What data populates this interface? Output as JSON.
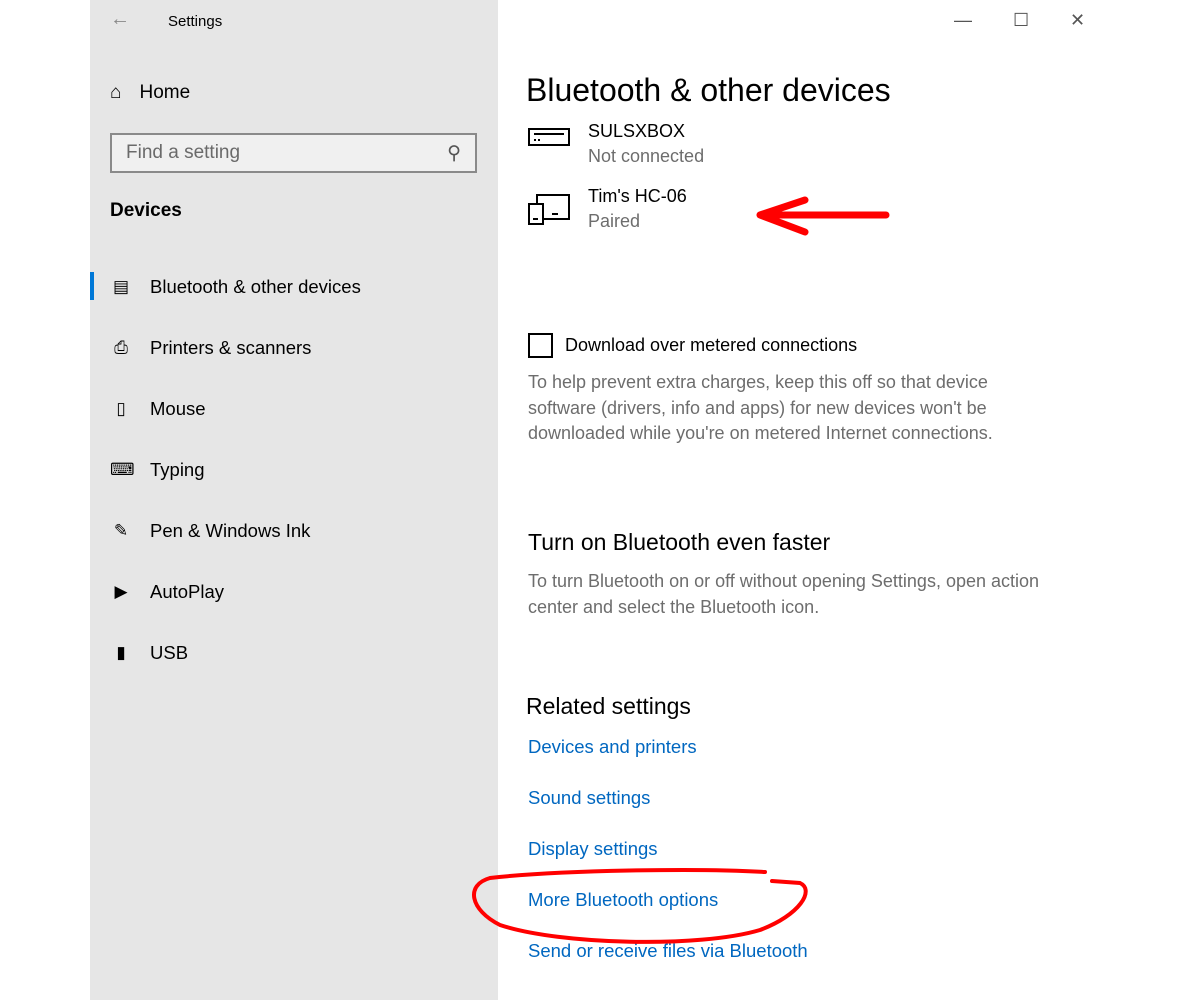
{
  "window": {
    "title": "Settings",
    "back_icon": "back-arrow-icon",
    "minimize": "minimize-icon",
    "maximize": "maximize-icon",
    "close": "close-icon"
  },
  "sidebar": {
    "home": "Home",
    "search_placeholder": "Find a setting",
    "section": "Devices",
    "items": [
      {
        "label": "Bluetooth & other devices",
        "icon": "bluetooth-devices-icon",
        "active": true
      },
      {
        "label": "Printers & scanners",
        "icon": "printer-icon"
      },
      {
        "label": "Mouse",
        "icon": "mouse-icon"
      },
      {
        "label": "Typing",
        "icon": "keyboard-icon"
      },
      {
        "label": "Pen & Windows Ink",
        "icon": "pen-icon"
      },
      {
        "label": "AutoPlay",
        "icon": "autoplay-icon"
      },
      {
        "label": "USB",
        "icon": "usb-icon"
      }
    ]
  },
  "main": {
    "title": "Bluetooth & other devices",
    "devices": [
      {
        "name": "SULSXBOX",
        "status": "Not connected",
        "icon": "console-icon"
      },
      {
        "name": "Tim's HC-06",
        "status": "Paired",
        "icon": "devices-icon"
      }
    ],
    "metered": {
      "label": "Download over metered connections",
      "checked": false,
      "description": "To help prevent extra charges, keep this off so that device software (drivers, info and apps) for new devices won't be downloaded while you're on metered Internet connections."
    },
    "faster": {
      "heading": "Turn on Bluetooth even faster",
      "description": "To turn Bluetooth on or off without opening Settings, open action center and select the Bluetooth icon."
    },
    "related": {
      "heading": "Related settings",
      "links": [
        "Devices and printers",
        "Sound settings",
        "Display settings",
        "More Bluetooth options",
        "Send or receive files via Bluetooth"
      ]
    }
  },
  "colors": {
    "accent": "#0078d7",
    "link": "#0067c0",
    "annotation": "#ff0000",
    "sidebar": "#e6e6e6"
  }
}
